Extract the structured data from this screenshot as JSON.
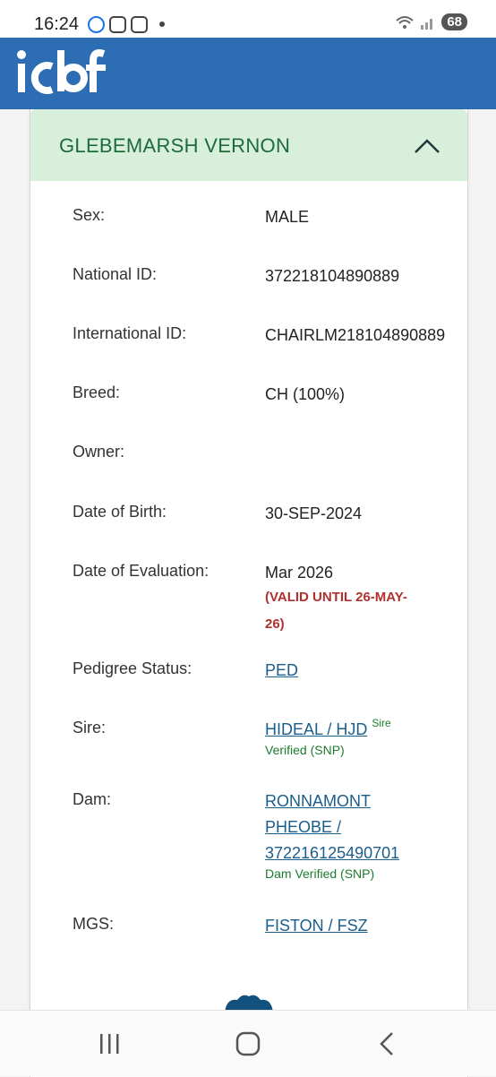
{
  "status_bar": {
    "time": "16:24",
    "battery": "68"
  },
  "header": {
    "logo_text": "icbf",
    "brand_color": "#2d6db4"
  },
  "card": {
    "title": "GLEBEMARSH VERNON",
    "header_color": "#d8efdc",
    "rows": {
      "sex": {
        "label": "Sex:",
        "value": "MALE"
      },
      "national_id": {
        "label": "National ID:",
        "value": "372218104890889"
      },
      "international_id": {
        "label": "International ID:",
        "value": "CHAIRLM218104890889"
      },
      "breed": {
        "label": "Breed:",
        "value": "CH (100%)"
      },
      "owner": {
        "label": "Owner:",
        "value": ""
      },
      "dob": {
        "label": "Date of Birth:",
        "value": "30-SEP-2024"
      },
      "evaluation": {
        "label": "Date of Evaluation:",
        "value": "Mar 2026",
        "valid_line1": "(VALID UNTIL 26-MAY-",
        "valid_line2": "26)"
      },
      "pedigree": {
        "label": "Pedigree Status:",
        "value": "PED"
      },
      "sire": {
        "label": "Sire:",
        "value": "HIDEAL / HJD",
        "sup": "Sire",
        "verified": "Verified (SNP)"
      },
      "dam": {
        "label": "Dam:",
        "line1": "RONNAMONT",
        "line2": "PHEOBE /",
        "line3": "372216125490701",
        "verified": "Dam Verified (SNP)"
      },
      "mgs": {
        "label": "MGS:",
        "value": "FISTON / FSZ"
      }
    }
  },
  "nav": {
    "icons": [
      "recent-apps-icon",
      "home-icon",
      "back-icon"
    ]
  }
}
